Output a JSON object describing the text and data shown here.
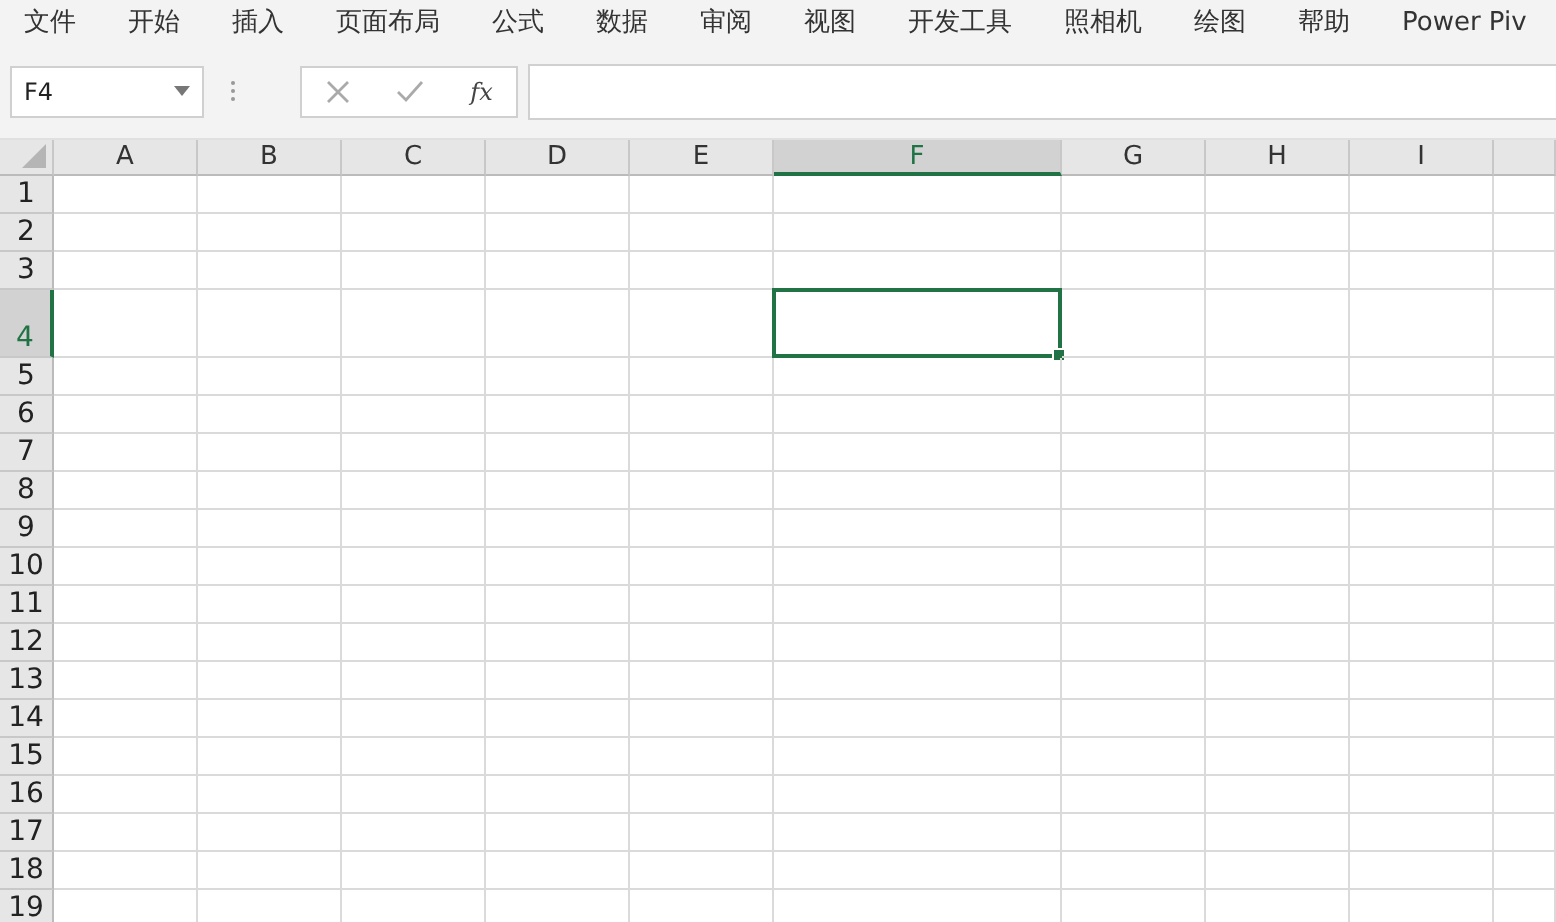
{
  "ribbon_tabs": [
    {
      "label": "文件"
    },
    {
      "label": "开始"
    },
    {
      "label": "插入"
    },
    {
      "label": "页面布局"
    },
    {
      "label": "公式"
    },
    {
      "label": "数据"
    },
    {
      "label": "审阅"
    },
    {
      "label": "视图"
    },
    {
      "label": "开发工具"
    },
    {
      "label": "照相机"
    },
    {
      "label": "绘图"
    },
    {
      "label": "帮助"
    },
    {
      "label": "Power Piv"
    }
  ],
  "formula_bar": {
    "name_box": "F4",
    "fx": "fx"
  },
  "columns": [
    {
      "label": "A",
      "selected": false
    },
    {
      "label": "B",
      "selected": false
    },
    {
      "label": "C",
      "selected": false
    },
    {
      "label": "D",
      "selected": false
    },
    {
      "label": "E",
      "selected": false
    },
    {
      "label": "F",
      "selected": true,
      "kind": "wide"
    },
    {
      "label": "G",
      "selected": false
    },
    {
      "label": "H",
      "selected": false
    },
    {
      "label": "I",
      "selected": false
    }
  ],
  "rows": [
    {
      "label": "1",
      "selected": false
    },
    {
      "label": "2",
      "selected": false
    },
    {
      "label": "3",
      "selected": false
    },
    {
      "label": "4",
      "selected": true,
      "kind": "tall"
    },
    {
      "label": "5",
      "selected": false
    },
    {
      "label": "6",
      "selected": false
    },
    {
      "label": "7",
      "selected": false
    },
    {
      "label": "8",
      "selected": false
    },
    {
      "label": "9",
      "selected": false
    },
    {
      "label": "10",
      "selected": false
    },
    {
      "label": "11",
      "selected": false
    },
    {
      "label": "12",
      "selected": false
    },
    {
      "label": "13",
      "selected": false
    },
    {
      "label": "14",
      "selected": false
    },
    {
      "label": "15",
      "selected": false
    },
    {
      "label": "16",
      "selected": false
    },
    {
      "label": "17",
      "selected": false
    },
    {
      "label": "18",
      "selected": false
    },
    {
      "label": "19",
      "selected": false
    }
  ]
}
